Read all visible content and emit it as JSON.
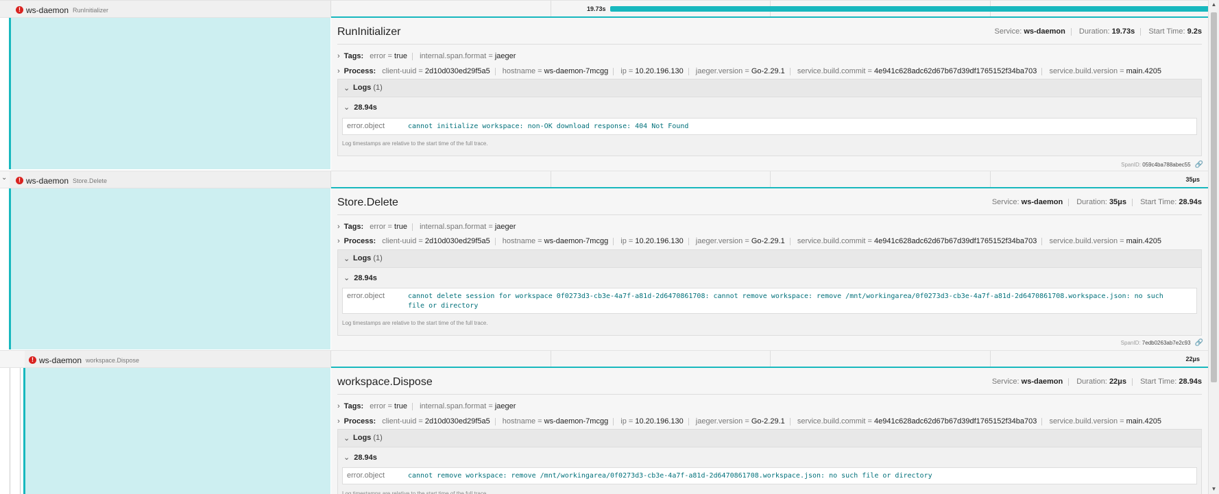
{
  "rows": [
    {
      "service": "ws-daemon",
      "operation": "RunInitializer",
      "duration_label": "19.73s",
      "detail": {
        "title": "RunInitializer",
        "service": "ws-daemon",
        "duration": "19.73s",
        "start_time": "9.2s",
        "tags": [
          {
            "k": "error",
            "v": "true"
          },
          {
            "k": "internal.span.format",
            "v": "jaeger"
          }
        ],
        "log_ts": "28.94s",
        "log_key": "error.object",
        "log_value": "cannot initialize workspace: non-OK download response: 404 Not Found",
        "span_id": "059c4ba788abec55"
      }
    },
    {
      "service": "ws-daemon",
      "operation": "Store.Delete",
      "duration_label": "35μs",
      "detail": {
        "title": "Store.Delete",
        "service": "ws-daemon",
        "duration": "35μs",
        "start_time": "28.94s",
        "tags": [
          {
            "k": "error",
            "v": "true"
          },
          {
            "k": "internal.span.format",
            "v": "jaeger"
          }
        ],
        "log_ts": "28.94s",
        "log_key": "error.object",
        "log_value": "cannot delete session for workspace 0f0273d3-cb3e-4a7f-a81d-2d6470861708: cannot remove workspace: remove /mnt/workingarea/0f0273d3-cb3e-4a7f-a81d-2d6470861708.workspace.json: no such file or directory",
        "span_id": "7edb0263ab7e2c93"
      }
    },
    {
      "service": "ws-daemon",
      "operation": "workspace.Dispose",
      "duration_label": "22μs",
      "detail": {
        "title": "workspace.Dispose",
        "service": "ws-daemon",
        "duration": "22μs",
        "start_time": "28.94s",
        "tags": [
          {
            "k": "error",
            "v": "true"
          },
          {
            "k": "internal.span.format",
            "v": "jaeger"
          }
        ],
        "log_ts": "28.94s",
        "log_key": "error.object",
        "log_value": "cannot remove workspace: remove /mnt/workingarea/0f0273d3-cb3e-4a7f-a81d-2d6470861708.workspace.json: no such file or directory",
        "span_id": ""
      }
    }
  ],
  "process": [
    {
      "k": "client-uuid",
      "v": "2d10d030ed29f5a5"
    },
    {
      "k": "hostname",
      "v": "ws-daemon-7mcgg"
    },
    {
      "k": "ip",
      "v": "10.20.196.130"
    },
    {
      "k": "jaeger.version",
      "v": "Go-2.29.1"
    },
    {
      "k": "service.build.commit",
      "v": "4e941c628adc62d67b67d39df1765152f34ba703"
    },
    {
      "k": "service.build.version",
      "v": "main.4205"
    }
  ],
  "labels": {
    "service": "Service:",
    "duration": "Duration:",
    "start_time": "Start Time:",
    "tags": "Tags:",
    "process": "Process:",
    "logs": "Logs",
    "logs_count": "(1)",
    "log_note": "Log timestamps are relative to the start time of the full trace.",
    "span_id": "SpanID:"
  },
  "colors": {
    "accent": "#17b8be",
    "error": "#d9221f",
    "left_fill": "#cdeff1"
  }
}
